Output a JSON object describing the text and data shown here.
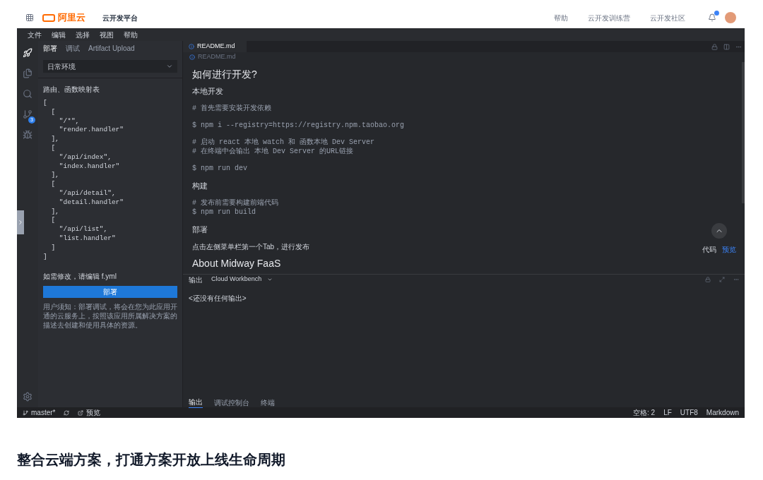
{
  "header": {
    "logo_text": "阿里云",
    "product": "云开发平台",
    "links": [
      "帮助",
      "云开发训练营",
      "云开发社区"
    ]
  },
  "menu": [
    "文件",
    "编辑",
    "选择",
    "视图",
    "帮助"
  ],
  "activity_bar": [
    {
      "kind": "deploy",
      "selected": true
    },
    {
      "kind": "files",
      "selected": false
    },
    {
      "kind": "search",
      "selected": false
    },
    {
      "kind": "scm",
      "selected": false,
      "badge": "3"
    },
    {
      "kind": "debug",
      "selected": false
    }
  ],
  "side_tabs": [
    {
      "label": "部署",
      "selected": true
    },
    {
      "label": "调试",
      "selected": false
    },
    {
      "label": "Artifact Upload",
      "selected": false
    }
  ],
  "env_select": {
    "value": "日常环境"
  },
  "routes_title": "路由、函数映射表",
  "routes_code": [
    "[",
    "  [",
    "    \"/*\",",
    "    \"render.handler\"",
    "  ],",
    "  [",
    "    \"/api/index\",",
    "    \"index.handler\"",
    "  ],",
    "  [",
    "    \"/api/detail\",",
    "    \"detail.handler\"",
    "  ],",
    "  [",
    "    \"/api/list\",",
    "    \"list.handler\"",
    "  ]",
    "]"
  ],
  "edit_hint": "如需修改，请编辑 f.yml",
  "deploy_button": "部署",
  "notice": "用户须知：部署调试，将会在您为此应用开通的云服务上，按照该应用所属解决方案的描述去创建和使用具体的资源。",
  "editor_tabs": [
    {
      "label": "README.md",
      "selected": true
    }
  ],
  "breadcrumb": "README.md",
  "readme": [
    {
      "kind": "h2",
      "text": "如何进行开发?"
    },
    {
      "kind": "h3",
      "text": "本地开发"
    },
    {
      "kind": "code",
      "lines": [
        "# 首先需要安装开发依赖"
      ]
    },
    {
      "kind": "code",
      "lines": [
        "$ npm i --registry=https://registry.npm.taobao.org"
      ]
    },
    {
      "kind": "code",
      "lines": [
        "# 启动 react 本地 watch 和 函数本地 Dev Server",
        "# 在终端中会输出 本地 Dev Server 的URL链接"
      ]
    },
    {
      "kind": "code",
      "lines": [
        "$ npm run dev"
      ]
    },
    {
      "kind": "h3",
      "text": "构建"
    },
    {
      "kind": "code",
      "lines": [
        "# 发布前需要构建前端代码",
        "$ npm run build"
      ]
    },
    {
      "kind": "h3",
      "text": "部署"
    },
    {
      "kind": "p",
      "text": "点击左侧菜单栏第一个Tab，进行发布"
    },
    {
      "kind": "h2",
      "text": "About Midway FaaS"
    }
  ],
  "view_toggle": [
    {
      "label": "代码",
      "selected": false
    },
    {
      "label": "预览",
      "selected": true
    }
  ],
  "output_panel": {
    "label": "输出",
    "channel": "Cloud Workbench",
    "text": "<还没有任何输出>"
  },
  "panel_tabs": [
    {
      "label": "输出",
      "selected": true
    },
    {
      "label": "调试控制台",
      "selected": false
    },
    {
      "label": "终端",
      "selected": false
    }
  ],
  "status_bar": {
    "branch": "master*",
    "preview": "预览",
    "right": [
      "空格: 2",
      "LF",
      "UTF8",
      "Markdown"
    ]
  },
  "caption": "整合云端方案，打通方案开放上线生命周期"
}
